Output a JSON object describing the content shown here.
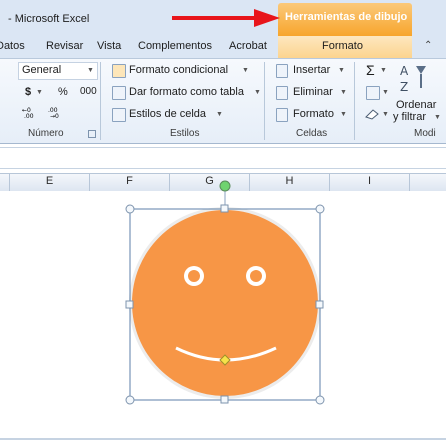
{
  "title_bar": {
    "window_title": "- Microsoft Excel",
    "contextual_tab_title": "Herramientas de dibujo"
  },
  "tabs": [
    {
      "label": "Datos"
    },
    {
      "label": "Revisar"
    },
    {
      "label": "Vista"
    },
    {
      "label": "Complementos"
    },
    {
      "label": "Acrobat"
    },
    {
      "label": "Formato"
    }
  ],
  "ribbon": {
    "numero": {
      "format_value": "General",
      "currency_symbol": "$",
      "percent_symbol": "%",
      "thousands_label": "000",
      "group_label": "Número"
    },
    "estilos": {
      "conditional_format": "Formato condicional",
      "format_as_table": "Dar formato como tabla",
      "cell_styles": "Estilos de celda",
      "group_label": "Estilos"
    },
    "celdas": {
      "insert": "Insertar",
      "delete": "Eliminar",
      "format": "Formato",
      "group_label": "Celdas"
    },
    "modificar": {
      "sum_symbol": "Σ",
      "sort_filter_line1": "Ordenar",
      "sort_filter_line2": "y filtrar",
      "group_label_partial": "Modi"
    }
  },
  "column_headers": [
    "E",
    "F",
    "G",
    "H",
    "I"
  ],
  "shape": {
    "type": "smiley-face",
    "fill": "#f79646",
    "state": "selected"
  },
  "colors": {
    "arrow": "#e8151b",
    "contextual_orange": "#f7a52c",
    "ribbon_blue": "#dbe6f4"
  }
}
